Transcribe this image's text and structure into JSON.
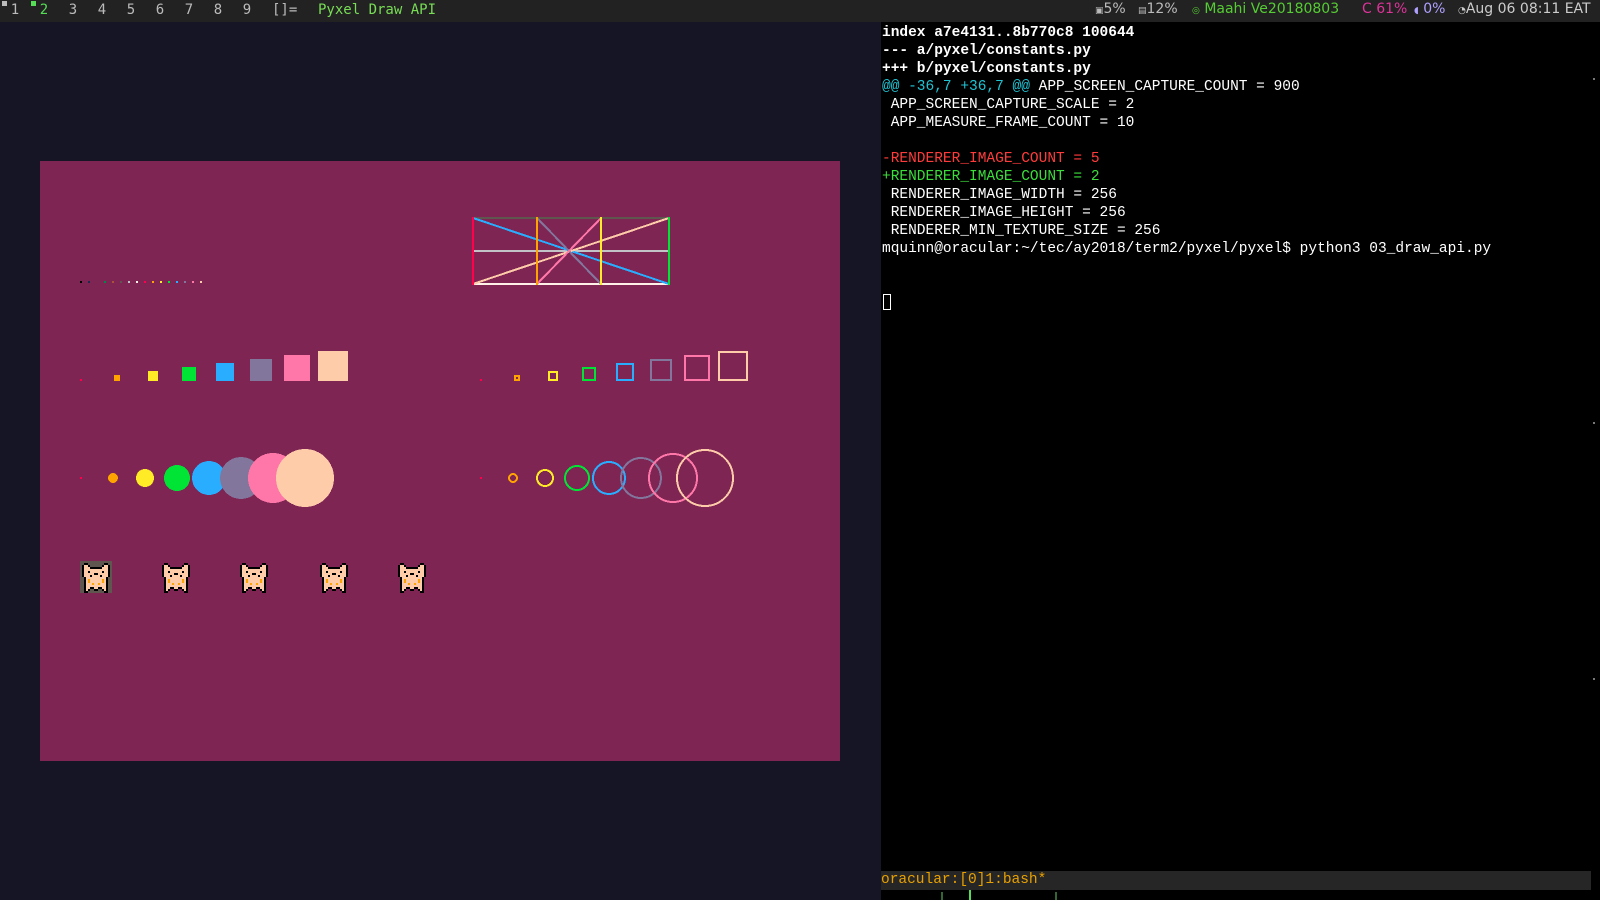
{
  "topbar": {
    "workspaces": [
      "1",
      "2",
      "3",
      "4",
      "5",
      "6",
      "7",
      "8",
      "9"
    ],
    "active_workspace": "2",
    "layout_symbol": "[]=",
    "window_title": "Pyxel Draw API",
    "status": {
      "cpu": "5%",
      "mem": "12%",
      "network": "Maahi Ve20180803",
      "battery": "C 61%",
      "volume": "0%",
      "datetime": "Aug 06 08:11 EAT"
    },
    "colors": {
      "cpu": "#bbbbbb",
      "mem": "#bbbbbb",
      "network": "#55cc33",
      "battery": "#dd3399",
      "volume": "#b0a0ff",
      "datetime": "#cccccc"
    }
  },
  "pyxel": {
    "background": "#7e2553",
    "palette": [
      "#000000",
      "#1d2b53",
      "#7e2553",
      "#008751",
      "#ab5236",
      "#5f574f",
      "#c2c3c7",
      "#fff1e8",
      "#ff004d",
      "#ffa300",
      "#ffec27",
      "#00e436",
      "#29adff",
      "#83769c",
      "#ff77a8",
      "#ffccaa"
    ]
  },
  "terminal": {
    "lines": [
      {
        "text": "index a7e4131..8b770c8 100644",
        "style": "bold"
      },
      {
        "text": "--- a/pyxel/constants.py",
        "style": "bold"
      },
      {
        "text": "+++ b/pyxel/constants.py",
        "style": "bold"
      },
      {
        "hunk": "@@ -36,7 +36,7 @@",
        "text": " APP_SCREEN_CAPTURE_COUNT = 900",
        "style": "hunk"
      },
      {
        "text": " APP_SCREEN_CAPTURE_SCALE = 2",
        "style": "normal"
      },
      {
        "text": " APP_MEASURE_FRAME_COUNT = 10",
        "style": "normal"
      },
      {
        "text": "",
        "style": "normal"
      },
      {
        "text": "-RENDERER_IMAGE_COUNT = 5",
        "style": "del"
      },
      {
        "text": "+RENDERER_IMAGE_COUNT = 2",
        "style": "add"
      },
      {
        "text": " RENDERER_IMAGE_WIDTH = 256",
        "style": "normal"
      },
      {
        "text": " RENDERER_IMAGE_HEIGHT = 256",
        "style": "normal"
      },
      {
        "text": " RENDERER_MIN_TEXTURE_SIZE = 256",
        "style": "normal"
      },
      {
        "text": "mquinn@oracular:~/tec/ay2018/term2/pyxel/pyxel$ python3 03_draw_api.py",
        "style": "normal"
      }
    ],
    "tmux_status": "oracular:[0]1:bash*"
  }
}
